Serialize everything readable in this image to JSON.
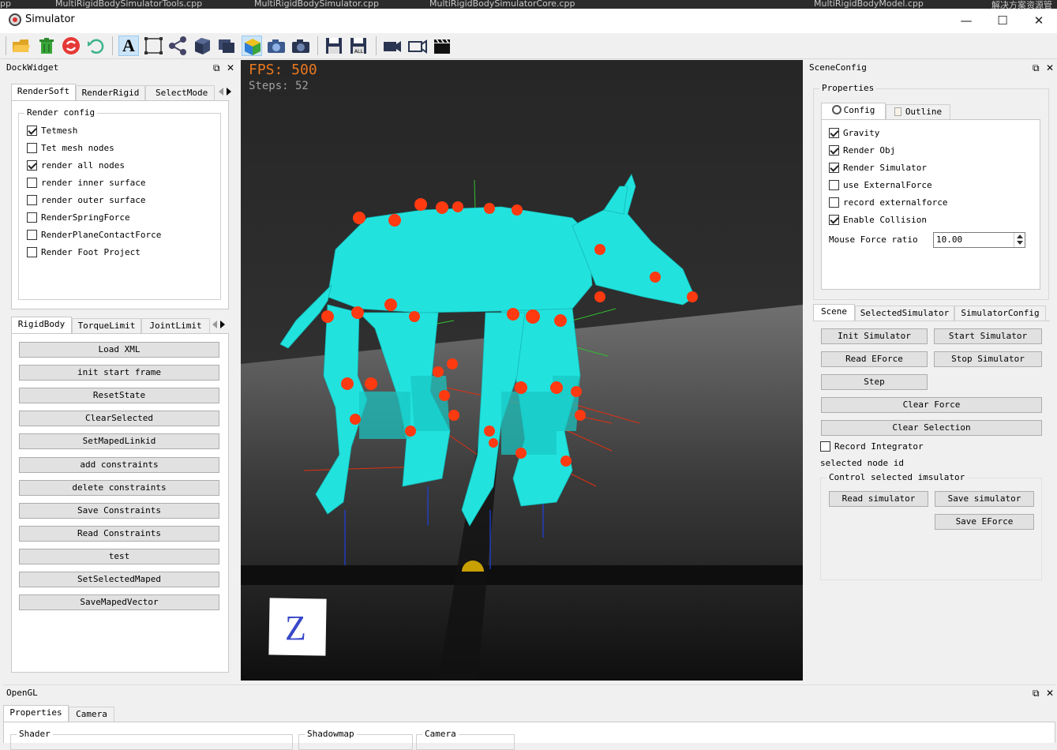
{
  "ide_tabs": [
    "pp",
    "MultiRigidBodySimulatorTools.cpp",
    "MultiRigidBodySimulator.cpp",
    "MultiRigidBodySimulatorCore.cpp",
    "MultiRigidBodyModel.cpp",
    "解决方案资源管"
  ],
  "window": {
    "title": "Simulator",
    "minimize": "—",
    "maximize": "☐",
    "close": "✕"
  },
  "toolbar": {
    "icons": [
      "folder-open-icon",
      "trash-icon",
      "refresh-icon",
      "undo-icon",
      "text-tool-icon",
      "select-rect-icon",
      "share-icon",
      "cube-icon",
      "layers-icon",
      "box-icon",
      "camera-blue-icon",
      "camera-icon",
      "save-icon",
      "save-all-icon",
      "video-camera-icon",
      "video-outline-icon",
      "clapperboard-icon"
    ],
    "text_tool_label": "A",
    "save_all_label": "ALL"
  },
  "left_dock": {
    "title": "DockWidget",
    "tabs": [
      "RenderSoft",
      "RenderRigid",
      "SelectMode"
    ],
    "render_config": {
      "title": "Render config",
      "items": [
        {
          "label": "Tetmesh",
          "checked": true
        },
        {
          "label": "Tet mesh nodes",
          "checked": false
        },
        {
          "label": "render all nodes",
          "checked": true
        },
        {
          "label": "render inner surface",
          "checked": false
        },
        {
          "label": "render outer surface",
          "checked": false
        },
        {
          "label": "RenderSpringForce",
          "checked": false
        },
        {
          "label": "RenderPlaneContactForce",
          "checked": false
        },
        {
          "label": "Render Foot Project",
          "checked": false
        }
      ]
    },
    "tabs2": [
      "RigidBody",
      "TorqueLimit",
      "JointLimit"
    ],
    "buttons": [
      "Load XML",
      "init start frame",
      "ResetState",
      "ClearSelected",
      "SetMapedLinkid",
      "add constraints",
      "delete constraints",
      "Save Constraints",
      "Read Constraints",
      "test",
      "SetSelectedMaped",
      "SaveMapedVector"
    ]
  },
  "viewport": {
    "fps": "FPS: 500",
    "steps": "Steps: 52",
    "axis_label": "Z"
  },
  "right_dock": {
    "title": "SceneConfig",
    "properties_title": "Properties",
    "tabs": [
      "Config",
      "Outline"
    ],
    "config_items": [
      {
        "label": "Gravity",
        "checked": true
      },
      {
        "label": "Render Obj",
        "checked": true
      },
      {
        "label": "Render Simulator",
        "checked": true
      },
      {
        "label": "use ExternalForce",
        "checked": false
      },
      {
        "label": "record externalforce",
        "checked": false
      },
      {
        "label": "Enable Collision",
        "checked": true
      }
    ],
    "mouse_force_label": "Mouse Force ratio",
    "mouse_force_value": "10.00",
    "scene_tabs": [
      "Scene",
      "SelectedSimulator",
      "SimulatorConfig"
    ],
    "scene_buttons": {
      "init": "Init Simulator",
      "start": "Start Simulator",
      "read_eforce": "Read EForce",
      "stop": "Stop Simulator",
      "step": "Step",
      "clear_force": "Clear Force",
      "clear_selection": "Clear Selection"
    },
    "record_integrator": {
      "label": "Record Integrator",
      "checked": false
    },
    "selected_node_id": "selected node id",
    "control_group": {
      "title": "Control selected imsulator",
      "read": "Read simulator",
      "save": "Save simulator",
      "save_eforce": "Save EForce"
    }
  },
  "bottom_dock": {
    "title": "OpenGL",
    "tabs": [
      "Properties",
      "Camera"
    ],
    "groups": [
      "Shader",
      "Shadowmap",
      "Camera"
    ]
  }
}
